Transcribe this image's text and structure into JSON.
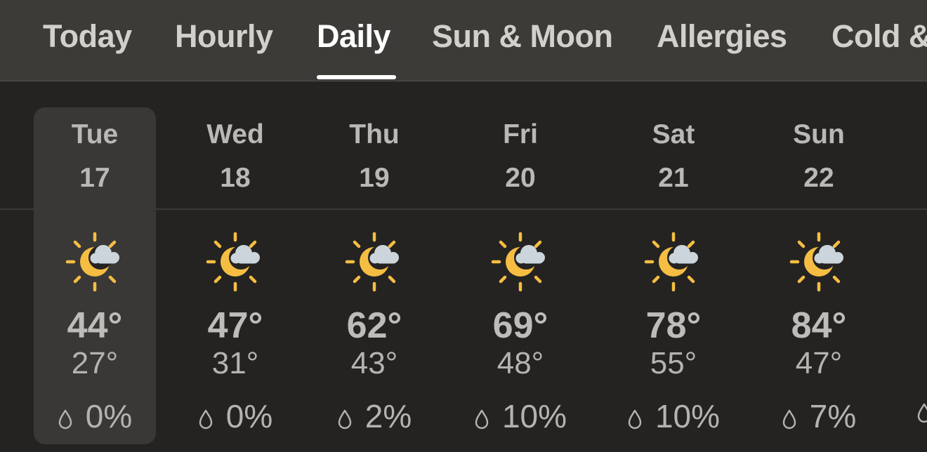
{
  "tabs": [
    {
      "label": "Today"
    },
    {
      "label": "Hourly"
    },
    {
      "label": "Daily"
    },
    {
      "label": "Sun & Moon"
    },
    {
      "label": "Allergies"
    },
    {
      "label": "Cold &"
    }
  ],
  "days": [
    {
      "day": "Tue",
      "date": "17",
      "high": "44°",
      "low": "27°",
      "precip": "0%",
      "condition": "partly-cloudy-icon"
    },
    {
      "day": "Wed",
      "date": "18",
      "high": "47°",
      "low": "31°",
      "precip": "0%",
      "condition": "partly-cloudy-icon"
    },
    {
      "day": "Thu",
      "date": "19",
      "high": "62°",
      "low": "43°",
      "precip": "2%",
      "condition": "partly-cloudy-icon"
    },
    {
      "day": "Fri",
      "date": "20",
      "high": "69°",
      "low": "48°",
      "precip": "10%",
      "condition": "partly-cloudy-icon"
    },
    {
      "day": "Sat",
      "date": "21",
      "high": "78°",
      "low": "55°",
      "precip": "10%",
      "condition": "partly-cloudy-icon"
    },
    {
      "day": "Sun",
      "date": "22",
      "high": "84°",
      "low": "47°",
      "precip": "7%",
      "condition": "partly-cloudy-icon"
    }
  ],
  "colors": {
    "sun": "#f5bd42",
    "cloud": "#ccd5dc",
    "tab_bg": "#3d3b38",
    "content_bg": "#242322",
    "selected_bg": "#393837"
  }
}
